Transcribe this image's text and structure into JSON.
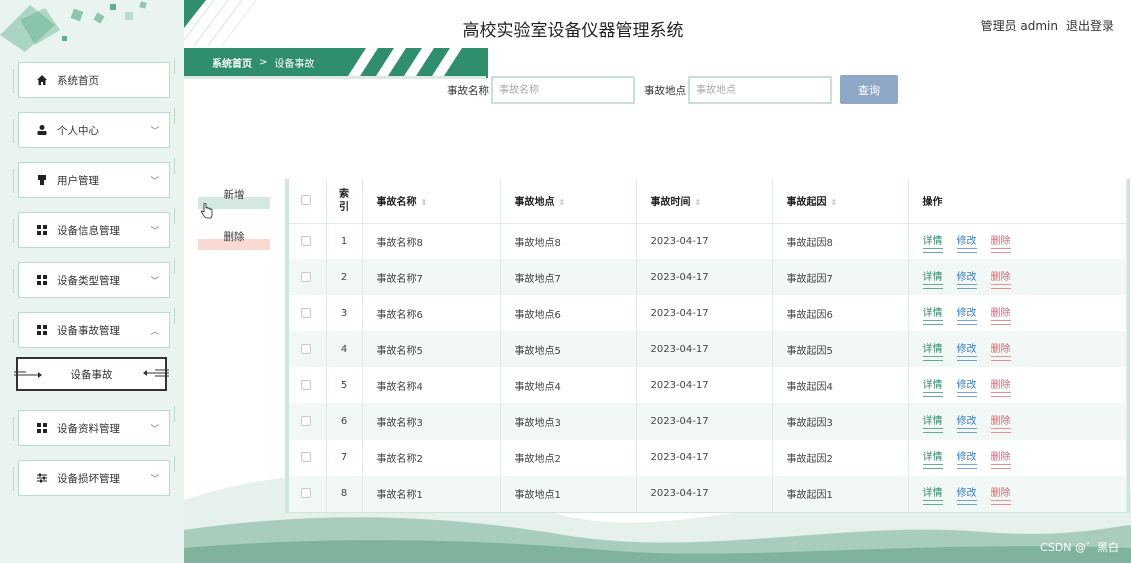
{
  "header": {
    "title": "高校实验室设备仪器管理系统",
    "user_label": "管理员 admin",
    "logout_label": "退出登录"
  },
  "sidebar": {
    "items": [
      {
        "label": "系统首页",
        "icon": "home-icon",
        "has_chevron": false
      },
      {
        "label": "个人中心",
        "icon": "person-icon",
        "has_chevron": true,
        "chevron": "down"
      },
      {
        "label": "用户管理",
        "icon": "user-manage-icon",
        "has_chevron": true,
        "chevron": "down"
      },
      {
        "label": "设备信息管理",
        "icon": "grid-icon",
        "has_chevron": true,
        "chevron": "down"
      },
      {
        "label": "设备类型管理",
        "icon": "grid-icon",
        "has_chevron": true,
        "chevron": "down"
      },
      {
        "label": "设备事故管理",
        "icon": "grid-icon",
        "has_chevron": true,
        "chevron": "up"
      },
      {
        "label": "设备资料管理",
        "icon": "grid-icon",
        "has_chevron": true,
        "chevron": "down"
      },
      {
        "label": "设备损坏管理",
        "icon": "sliders-icon",
        "has_chevron": true,
        "chevron": "down"
      }
    ],
    "submenu": {
      "label": "设备事故"
    }
  },
  "breadcrumb": {
    "home": "系统首页",
    "separator": ">",
    "current": "设备事故"
  },
  "search": {
    "name_label": "事故名称",
    "name_placeholder": "事故名称",
    "location_label": "事故地点",
    "location_placeholder": "事故地点",
    "button_label": "查询"
  },
  "actions": {
    "add_label": "新增",
    "delete_label": "删除"
  },
  "table": {
    "headers": {
      "index": "索引",
      "name": "事故名称",
      "location": "事故地点",
      "time": "事故时间",
      "cause": "事故起因",
      "ops": "操作"
    },
    "rows": [
      {
        "index": "1",
        "name": "事故名称8",
        "location": "事故地点8",
        "time": "2023-04-17",
        "cause": "事故起因8"
      },
      {
        "index": "2",
        "name": "事故名称7",
        "location": "事故地点7",
        "time": "2023-04-17",
        "cause": "事故起因7"
      },
      {
        "index": "3",
        "name": "事故名称6",
        "location": "事故地点6",
        "time": "2023-04-17",
        "cause": "事故起因6"
      },
      {
        "index": "4",
        "name": "事故名称5",
        "location": "事故地点5",
        "time": "2023-04-17",
        "cause": "事故起因5"
      },
      {
        "index": "5",
        "name": "事故名称4",
        "location": "事故地点4",
        "time": "2023-04-17",
        "cause": "事故起因4"
      },
      {
        "index": "6",
        "name": "事故名称3",
        "location": "事故地点3",
        "time": "2023-04-17",
        "cause": "事故起因3"
      },
      {
        "index": "7",
        "name": "事故名称2",
        "location": "事故地点2",
        "time": "2023-04-17",
        "cause": "事故起因2"
      },
      {
        "index": "8",
        "name": "事故名称1",
        "location": "事故地点1",
        "time": "2023-04-17",
        "cause": "事故起因1"
      }
    ],
    "ops": {
      "detail": "详情",
      "edit": "修改",
      "delete": "删除"
    }
  },
  "watermark": "CSDN @゛黑白",
  "colors": {
    "accent": "#2f8f6c",
    "sidebar_bg": "#e9f4ef",
    "search_button": "#8fa8c8",
    "detail_link": "#2c8a66",
    "edit_link": "#3a7ec8",
    "delete_link": "#e0626b"
  }
}
